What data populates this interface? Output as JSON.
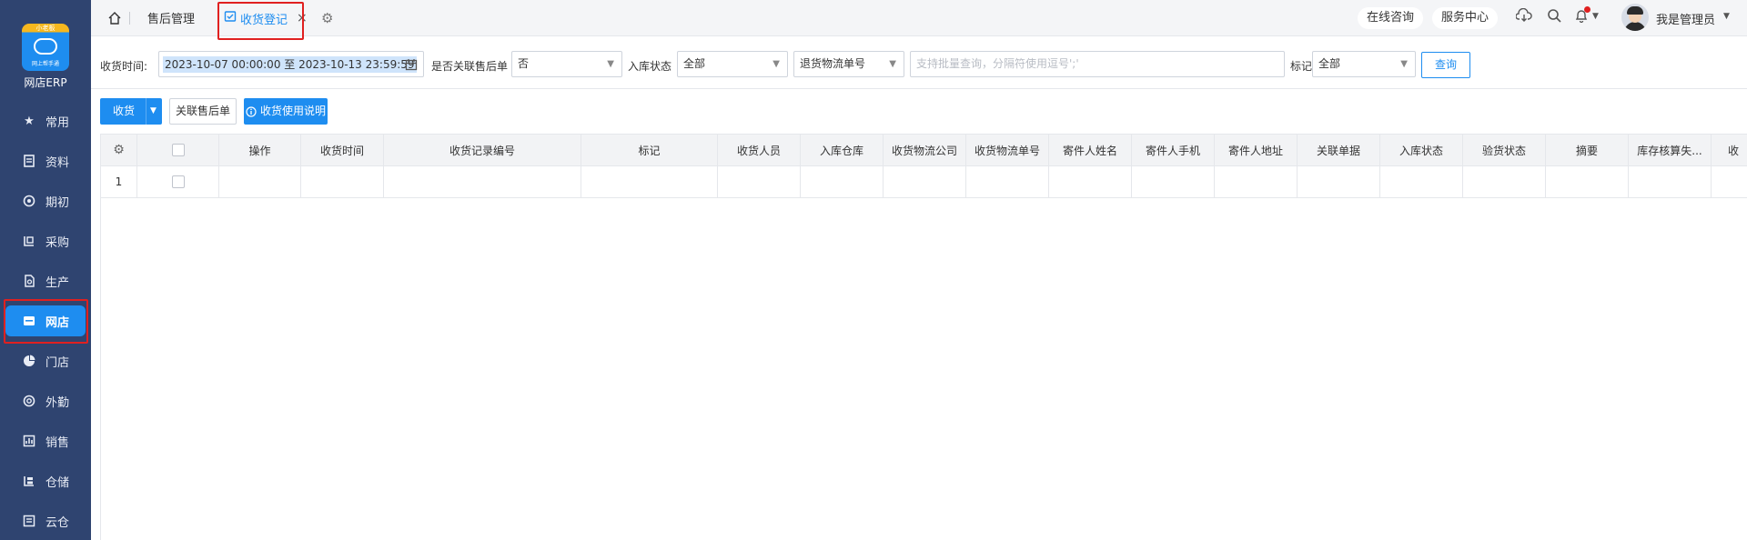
{
  "sidebar": {
    "logo_badge": "小老板",
    "logo_caption": "网上帮手通",
    "app_name": "网店ERP",
    "items": [
      {
        "label": "常用",
        "icon": "star-icon"
      },
      {
        "label": "资料",
        "icon": "document-icon"
      },
      {
        "label": "期初",
        "icon": "target-icon"
      },
      {
        "label": "采购",
        "icon": "purchase-icon"
      },
      {
        "label": "生产",
        "icon": "production-icon"
      },
      {
        "label": "网店",
        "icon": "store-icon",
        "active": true
      },
      {
        "label": "门店",
        "icon": "pie-icon"
      },
      {
        "label": "外勤",
        "icon": "location-icon"
      },
      {
        "label": "销售",
        "icon": "sales-icon"
      },
      {
        "label": "仓储",
        "icon": "warehouse-icon"
      },
      {
        "label": "云仓",
        "icon": "cloud-warehouse-icon"
      }
    ]
  },
  "topbar": {
    "tabs": [
      {
        "label": "售后管理"
      },
      {
        "label": "收货登记",
        "active": true
      }
    ],
    "close_glyph": "×",
    "online_consult": "在线咨询",
    "service_center": "服务中心",
    "user_name": "我是管理员"
  },
  "filters": {
    "time_label": "收货时间:",
    "date_range": "2023-10-07 00:00:00  至  2023-10-13 23:59:59",
    "linked_label": "是否关联售后单",
    "linked_value": "否",
    "stock_label": "入库状态",
    "stock_value": "全部",
    "tracking_type": "退货物流单号",
    "search_placeholder": "支持批量查询，分隔符使用逗号';'",
    "mark_label": "标记",
    "mark_value": "全部",
    "query_button": "查询"
  },
  "actions": {
    "receive_button": "收货",
    "link_button": "关联售后单",
    "help_button": "收货使用说明"
  },
  "table": {
    "columns": [
      "操作",
      "收货时间",
      "收货记录编号",
      "标记",
      "收货人员",
      "入库仓库",
      "收货物流公司",
      "收货物流单号",
      "寄件人姓名",
      "寄件人手机",
      "寄件人地址",
      "关联单据",
      "入库状态",
      "验货状态",
      "摘要",
      "库存核算失...",
      "收"
    ],
    "rows": [
      {
        "index": "1"
      }
    ]
  },
  "colors": {
    "sidebar_bg": "#2f4470",
    "accent": "#1e8df0",
    "highlight_box": "#e02020"
  }
}
